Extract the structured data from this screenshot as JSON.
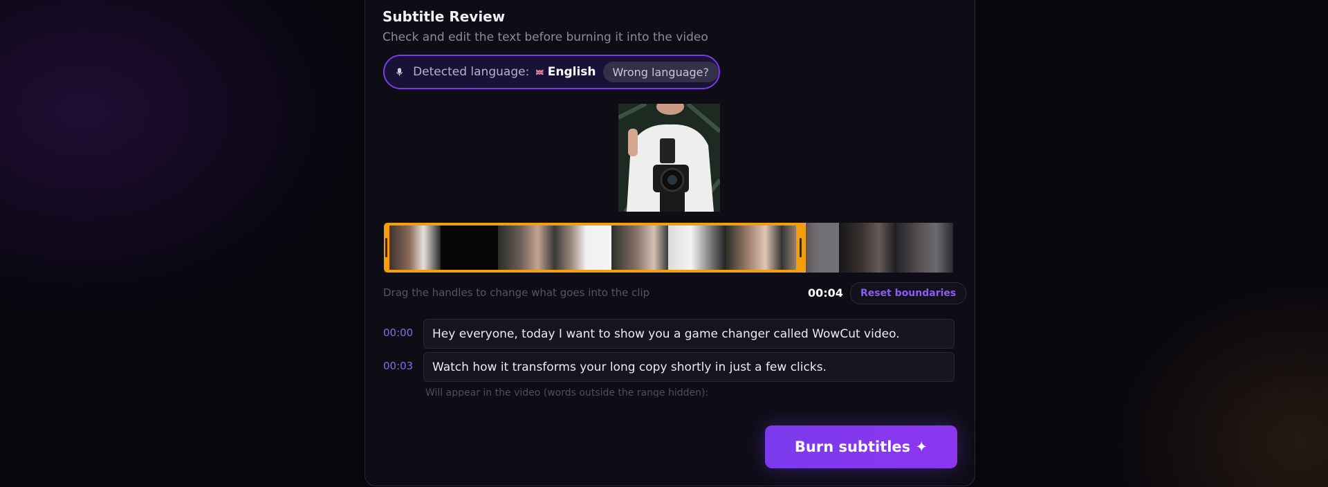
{
  "review": {
    "title": "Subtitle Review",
    "subtitle": "Check and edit the text before burning it into the video"
  },
  "language": {
    "label": "Detected language:",
    "value": "English",
    "flag_icon": "uk-flag-icon",
    "mic_icon": "microphone-icon",
    "wrong_button": "Wrong language?"
  },
  "clip": {
    "hint": "Drag the handles to change what goes into the clip",
    "duration": "00:04",
    "reset_button": "Reset boundaries"
  },
  "segments": [
    {
      "time": "00:00",
      "text": "Hey everyone, today I want to show you a game changer called WowCut video."
    },
    {
      "time": "00:03",
      "text": "Watch how it transforms your long copy shortly in just a few clicks."
    }
  ],
  "note": "Will appear in the video (words outside the range hidden):",
  "burn_button": "Burn subtitles ✦",
  "colors": {
    "accent": "#7c3aed",
    "selection": "#f59e0b",
    "timestamp": "#7c6cf0"
  }
}
